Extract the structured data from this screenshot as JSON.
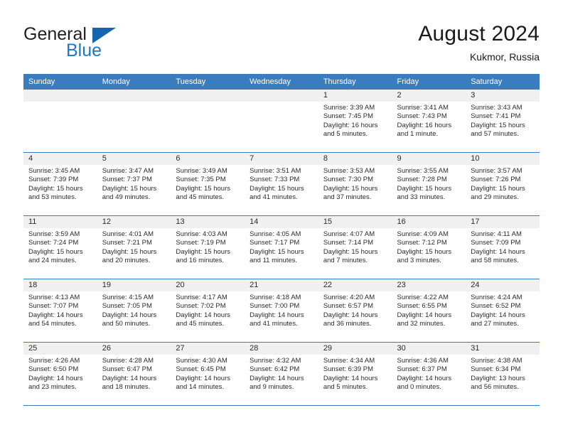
{
  "brand": {
    "name_part1": "General",
    "name_part2": "Blue",
    "flag_icon": "triangle-flag-icon",
    "accent_color": "#1b78c6"
  },
  "header": {
    "title": "August 2024",
    "subtitle": "Kukmor, Russia"
  },
  "calendar": {
    "header_bg": "#3a7dbf",
    "daynum_band_bg": "#f0f0f0",
    "weekdays": [
      "Sunday",
      "Monday",
      "Tuesday",
      "Wednesday",
      "Thursday",
      "Friday",
      "Saturday"
    ],
    "weeks": [
      [
        {
          "day": "",
          "sunrise": "",
          "sunset": "",
          "daylight_line1": "",
          "daylight_line2": "",
          "empty": true
        },
        {
          "day": "",
          "sunrise": "",
          "sunset": "",
          "daylight_line1": "",
          "daylight_line2": "",
          "empty": true
        },
        {
          "day": "",
          "sunrise": "",
          "sunset": "",
          "daylight_line1": "",
          "daylight_line2": "",
          "empty": true
        },
        {
          "day": "",
          "sunrise": "",
          "sunset": "",
          "daylight_line1": "",
          "daylight_line2": "",
          "empty": true
        },
        {
          "day": "1",
          "sunrise": "Sunrise: 3:39 AM",
          "sunset": "Sunset: 7:45 PM",
          "daylight_line1": "Daylight: 16 hours",
          "daylight_line2": "and 5 minutes.",
          "empty": false
        },
        {
          "day": "2",
          "sunrise": "Sunrise: 3:41 AM",
          "sunset": "Sunset: 7:43 PM",
          "daylight_line1": "Daylight: 16 hours",
          "daylight_line2": "and 1 minute.",
          "empty": false
        },
        {
          "day": "3",
          "sunrise": "Sunrise: 3:43 AM",
          "sunset": "Sunset: 7:41 PM",
          "daylight_line1": "Daylight: 15 hours",
          "daylight_line2": "and 57 minutes.",
          "empty": false
        }
      ],
      [
        {
          "day": "4",
          "sunrise": "Sunrise: 3:45 AM",
          "sunset": "Sunset: 7:39 PM",
          "daylight_line1": "Daylight: 15 hours",
          "daylight_line2": "and 53 minutes.",
          "empty": false
        },
        {
          "day": "5",
          "sunrise": "Sunrise: 3:47 AM",
          "sunset": "Sunset: 7:37 PM",
          "daylight_line1": "Daylight: 15 hours",
          "daylight_line2": "and 49 minutes.",
          "empty": false
        },
        {
          "day": "6",
          "sunrise": "Sunrise: 3:49 AM",
          "sunset": "Sunset: 7:35 PM",
          "daylight_line1": "Daylight: 15 hours",
          "daylight_line2": "and 45 minutes.",
          "empty": false
        },
        {
          "day": "7",
          "sunrise": "Sunrise: 3:51 AM",
          "sunset": "Sunset: 7:33 PM",
          "daylight_line1": "Daylight: 15 hours",
          "daylight_line2": "and 41 minutes.",
          "empty": false
        },
        {
          "day": "8",
          "sunrise": "Sunrise: 3:53 AM",
          "sunset": "Sunset: 7:30 PM",
          "daylight_line1": "Daylight: 15 hours",
          "daylight_line2": "and 37 minutes.",
          "empty": false
        },
        {
          "day": "9",
          "sunrise": "Sunrise: 3:55 AM",
          "sunset": "Sunset: 7:28 PM",
          "daylight_line1": "Daylight: 15 hours",
          "daylight_line2": "and 33 minutes.",
          "empty": false
        },
        {
          "day": "10",
          "sunrise": "Sunrise: 3:57 AM",
          "sunset": "Sunset: 7:26 PM",
          "daylight_line1": "Daylight: 15 hours",
          "daylight_line2": "and 29 minutes.",
          "empty": false
        }
      ],
      [
        {
          "day": "11",
          "sunrise": "Sunrise: 3:59 AM",
          "sunset": "Sunset: 7:24 PM",
          "daylight_line1": "Daylight: 15 hours",
          "daylight_line2": "and 24 minutes.",
          "empty": false
        },
        {
          "day": "12",
          "sunrise": "Sunrise: 4:01 AM",
          "sunset": "Sunset: 7:21 PM",
          "daylight_line1": "Daylight: 15 hours",
          "daylight_line2": "and 20 minutes.",
          "empty": false
        },
        {
          "day": "13",
          "sunrise": "Sunrise: 4:03 AM",
          "sunset": "Sunset: 7:19 PM",
          "daylight_line1": "Daylight: 15 hours",
          "daylight_line2": "and 16 minutes.",
          "empty": false
        },
        {
          "day": "14",
          "sunrise": "Sunrise: 4:05 AM",
          "sunset": "Sunset: 7:17 PM",
          "daylight_line1": "Daylight: 15 hours",
          "daylight_line2": "and 11 minutes.",
          "empty": false
        },
        {
          "day": "15",
          "sunrise": "Sunrise: 4:07 AM",
          "sunset": "Sunset: 7:14 PM",
          "daylight_line1": "Daylight: 15 hours",
          "daylight_line2": "and 7 minutes.",
          "empty": false
        },
        {
          "day": "16",
          "sunrise": "Sunrise: 4:09 AM",
          "sunset": "Sunset: 7:12 PM",
          "daylight_line1": "Daylight: 15 hours",
          "daylight_line2": "and 3 minutes.",
          "empty": false
        },
        {
          "day": "17",
          "sunrise": "Sunrise: 4:11 AM",
          "sunset": "Sunset: 7:09 PM",
          "daylight_line1": "Daylight: 14 hours",
          "daylight_line2": "and 58 minutes.",
          "empty": false
        }
      ],
      [
        {
          "day": "18",
          "sunrise": "Sunrise: 4:13 AM",
          "sunset": "Sunset: 7:07 PM",
          "daylight_line1": "Daylight: 14 hours",
          "daylight_line2": "and 54 minutes.",
          "empty": false
        },
        {
          "day": "19",
          "sunrise": "Sunrise: 4:15 AM",
          "sunset": "Sunset: 7:05 PM",
          "daylight_line1": "Daylight: 14 hours",
          "daylight_line2": "and 50 minutes.",
          "empty": false
        },
        {
          "day": "20",
          "sunrise": "Sunrise: 4:17 AM",
          "sunset": "Sunset: 7:02 PM",
          "daylight_line1": "Daylight: 14 hours",
          "daylight_line2": "and 45 minutes.",
          "empty": false
        },
        {
          "day": "21",
          "sunrise": "Sunrise: 4:18 AM",
          "sunset": "Sunset: 7:00 PM",
          "daylight_line1": "Daylight: 14 hours",
          "daylight_line2": "and 41 minutes.",
          "empty": false
        },
        {
          "day": "22",
          "sunrise": "Sunrise: 4:20 AM",
          "sunset": "Sunset: 6:57 PM",
          "daylight_line1": "Daylight: 14 hours",
          "daylight_line2": "and 36 minutes.",
          "empty": false
        },
        {
          "day": "23",
          "sunrise": "Sunrise: 4:22 AM",
          "sunset": "Sunset: 6:55 PM",
          "daylight_line1": "Daylight: 14 hours",
          "daylight_line2": "and 32 minutes.",
          "empty": false
        },
        {
          "day": "24",
          "sunrise": "Sunrise: 4:24 AM",
          "sunset": "Sunset: 6:52 PM",
          "daylight_line1": "Daylight: 14 hours",
          "daylight_line2": "and 27 minutes.",
          "empty": false
        }
      ],
      [
        {
          "day": "25",
          "sunrise": "Sunrise: 4:26 AM",
          "sunset": "Sunset: 6:50 PM",
          "daylight_line1": "Daylight: 14 hours",
          "daylight_line2": "and 23 minutes.",
          "empty": false
        },
        {
          "day": "26",
          "sunrise": "Sunrise: 4:28 AM",
          "sunset": "Sunset: 6:47 PM",
          "daylight_line1": "Daylight: 14 hours",
          "daylight_line2": "and 18 minutes.",
          "empty": false
        },
        {
          "day": "27",
          "sunrise": "Sunrise: 4:30 AM",
          "sunset": "Sunset: 6:45 PM",
          "daylight_line1": "Daylight: 14 hours",
          "daylight_line2": "and 14 minutes.",
          "empty": false
        },
        {
          "day": "28",
          "sunrise": "Sunrise: 4:32 AM",
          "sunset": "Sunset: 6:42 PM",
          "daylight_line1": "Daylight: 14 hours",
          "daylight_line2": "and 9 minutes.",
          "empty": false
        },
        {
          "day": "29",
          "sunrise": "Sunrise: 4:34 AM",
          "sunset": "Sunset: 6:39 PM",
          "daylight_line1": "Daylight: 14 hours",
          "daylight_line2": "and 5 minutes.",
          "empty": false
        },
        {
          "day": "30",
          "sunrise": "Sunrise: 4:36 AM",
          "sunset": "Sunset: 6:37 PM",
          "daylight_line1": "Daylight: 14 hours",
          "daylight_line2": "and 0 minutes.",
          "empty": false
        },
        {
          "day": "31",
          "sunrise": "Sunrise: 4:38 AM",
          "sunset": "Sunset: 6:34 PM",
          "daylight_line1": "Daylight: 13 hours",
          "daylight_line2": "and 56 minutes.",
          "empty": false
        }
      ]
    ]
  }
}
